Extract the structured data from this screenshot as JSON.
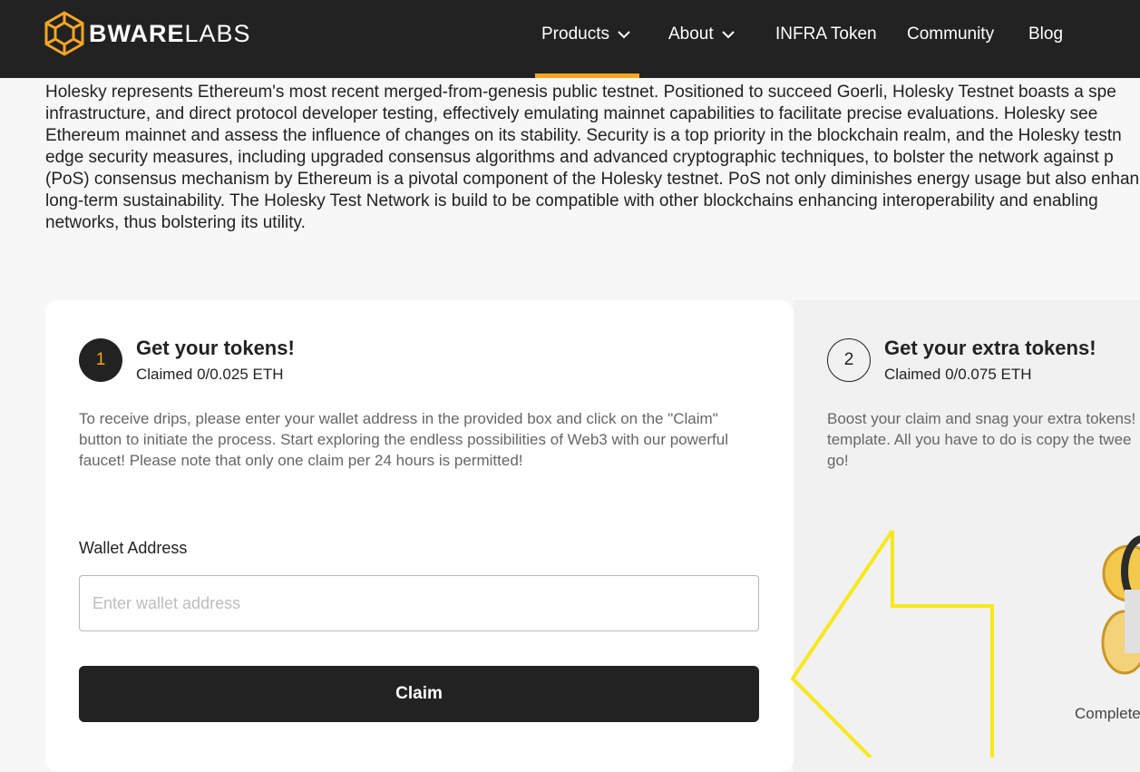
{
  "nav": {
    "logo_bold": "BWARE",
    "logo_light": "LABS",
    "items": [
      {
        "label": "Products",
        "has_dropdown": true,
        "active": true
      },
      {
        "label": "About",
        "has_dropdown": true,
        "active": false
      },
      {
        "label": "INFRA Token",
        "has_dropdown": false,
        "active": false
      },
      {
        "label": "Community",
        "has_dropdown": false,
        "active": false
      },
      {
        "label": "Blog",
        "has_dropdown": false,
        "active": false
      }
    ],
    "accent_color": "#f5a623",
    "background_color": "#222222"
  },
  "intro_lines": [
    "Holesky represents Ethereum's most recent merged-from-genesis public testnet. Positioned to succeed Goerli, Holesky Testnet boasts a spe",
    "infrastructure, and direct protocol developer testing, effectively emulating mainnet capabilities to facilitate precise evaluations. Holesky see",
    "Ethereum mainnet and assess the influence of changes on its stability. Security is a top priority in the blockchain realm, and the Holesky testn",
    "edge security measures, including upgraded consensus algorithms and advanced cryptographic techniques, to bolster the network against p",
    "(PoS) consensus mechanism by Ethereum is a pivotal component of the Holesky testnet. PoS not only diminishes energy usage but also enhan",
    "long-term sustainability. The Holesky Test Network is build to be compatible with other blockchains enhancing interoperability and enabling",
    "networks, thus bolstering its utility."
  ],
  "card1": {
    "step": "1",
    "title": "Get your tokens!",
    "claimed": "Claimed 0/0.025 ETH",
    "description_lines": [
      "To receive drips, please enter your wallet address in the provided box and click on the \"Claim\"",
      "button to initiate the process. Start exploring the endless possibilities of Web3 with our powerful",
      "faucet! Please note that only one claim per 24 hours is permitted!"
    ],
    "wallet_label": "Wallet Address",
    "wallet_placeholder": "Enter wallet address",
    "wallet_value": "",
    "claim_label": "Claim"
  },
  "card2": {
    "step": "2",
    "title": "Get your extra tokens!",
    "claimed": "Claimed 0/0.075 ETH",
    "description_lines": [
      "Boost your claim and snag your extra tokens!",
      "template. All you have to do is copy the twee",
      "go!"
    ],
    "complete_text": "Complete"
  },
  "icons": {
    "logo": "cube-logo-icon",
    "dropdown": "chevron-down-icon",
    "overlay": "pointer-arrow-icon",
    "coin": "coin-illustration-icon"
  }
}
